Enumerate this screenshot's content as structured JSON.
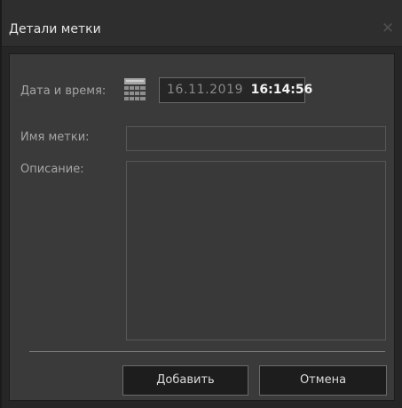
{
  "dialog": {
    "title": "Детали метки",
    "close_glyph": "✕"
  },
  "form": {
    "datetime_label": "Дата и время:",
    "date": "16.11.2019",
    "time_hours": "16",
    "time_minutes": "14",
    "time_seconds": "56",
    "time_separator": ":",
    "name_label": "Имя метки:",
    "name_value": "",
    "description_label": "Описание:",
    "description_value": ""
  },
  "buttons": {
    "add_label": "Добавить",
    "cancel_label": "Отмена"
  },
  "icons": {
    "calendar": "calendar-icon",
    "close": "close-icon"
  },
  "colors": {
    "window_bg": "#262626",
    "panel_bg": "#3a3a3a",
    "label_text": "#a5a5a5",
    "time_text": "#f2f2f2"
  }
}
